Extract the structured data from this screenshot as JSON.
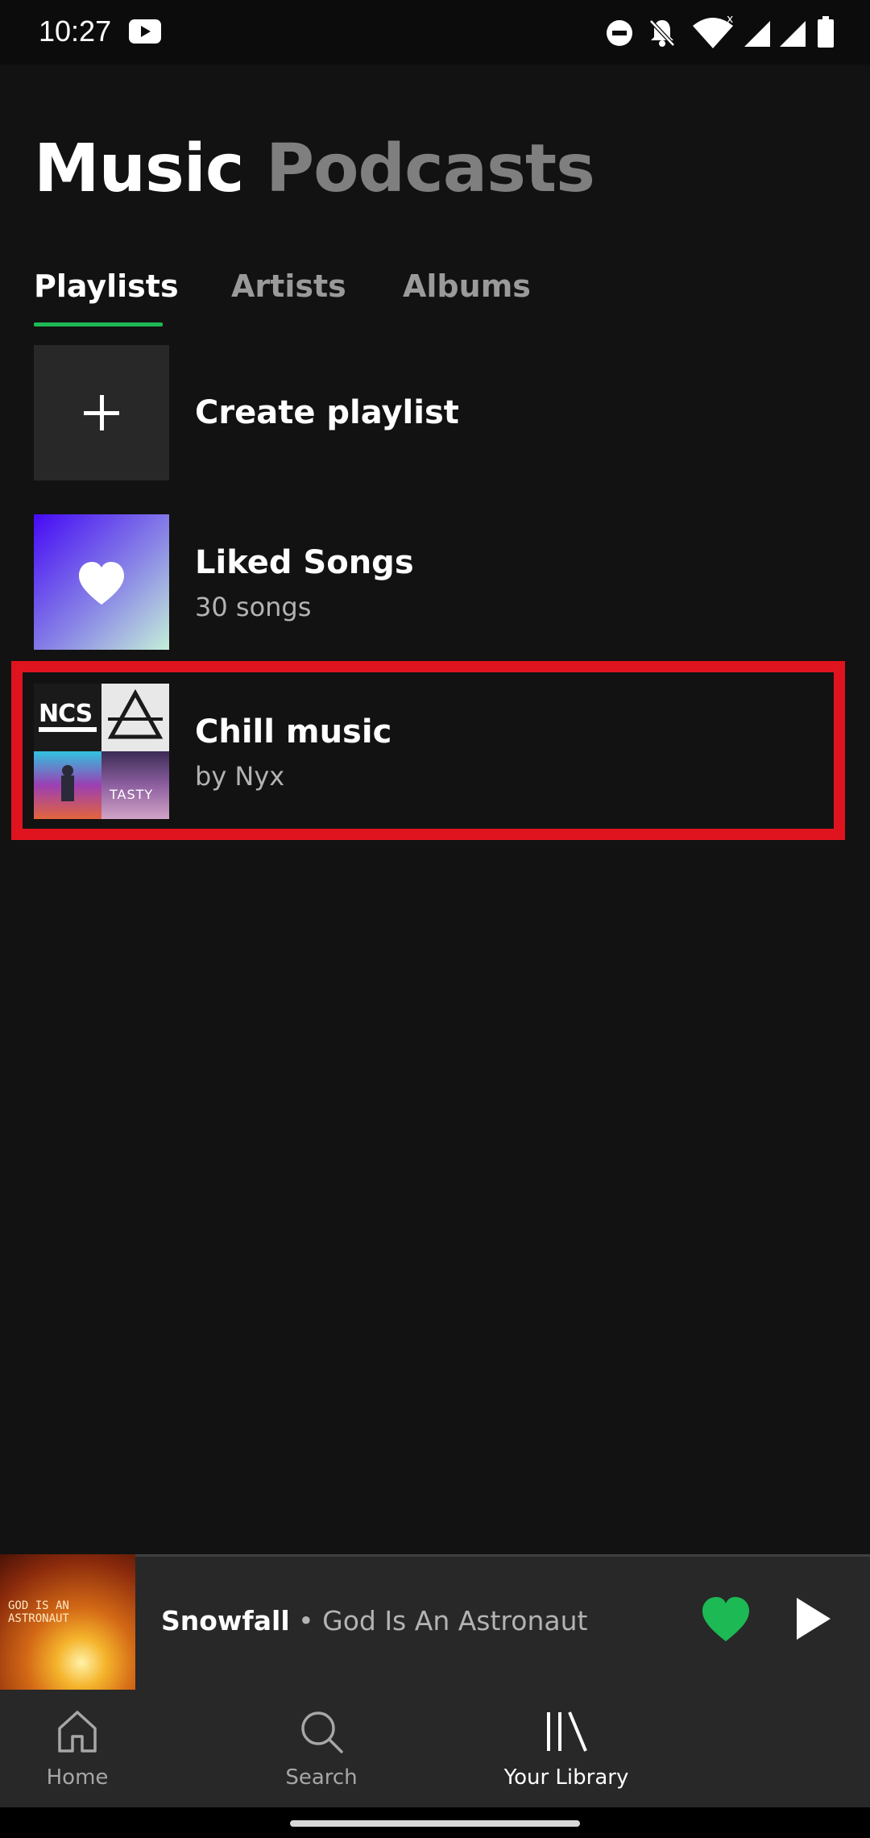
{
  "status_bar": {
    "time": "10:27",
    "icons": [
      "youtube-icon",
      "do-not-disturb-icon",
      "notifications-off-icon",
      "wifi-icon",
      "signal-icon",
      "signal-icon",
      "battery-icon"
    ]
  },
  "top_tabs": [
    {
      "label": "Music",
      "active": true
    },
    {
      "label": "Podcasts",
      "active": false
    }
  ],
  "sub_tabs": [
    {
      "label": "Playlists",
      "active": true
    },
    {
      "label": "Artists",
      "active": false
    },
    {
      "label": "Albums",
      "active": false
    }
  ],
  "library": {
    "create": {
      "label": "Create playlist",
      "icon": "plus-icon"
    },
    "liked": {
      "title": "Liked Songs",
      "subtitle": "30 songs",
      "icon": "heart-icon"
    },
    "playlists": [
      {
        "title": "Chill music",
        "subtitle": "by Nyx",
        "art_labels": [
          "NCS",
          "TASTY"
        ]
      }
    ]
  },
  "now_playing": {
    "title": "Snowfall",
    "separator": " • ",
    "artist": "God Is An Astronaut",
    "art_text": "GOD IS AN\nASTRONAUT",
    "liked": true
  },
  "bottom_nav": [
    {
      "label": "Home",
      "icon": "home-icon",
      "active": false
    },
    {
      "label": "Search",
      "icon": "search-icon",
      "active": false
    },
    {
      "label": "Your Library",
      "icon": "library-icon",
      "active": true
    }
  ],
  "colors": {
    "background": "#121212",
    "accent": "#1db954",
    "highlight": "#e0141e",
    "surface": "#282828"
  }
}
